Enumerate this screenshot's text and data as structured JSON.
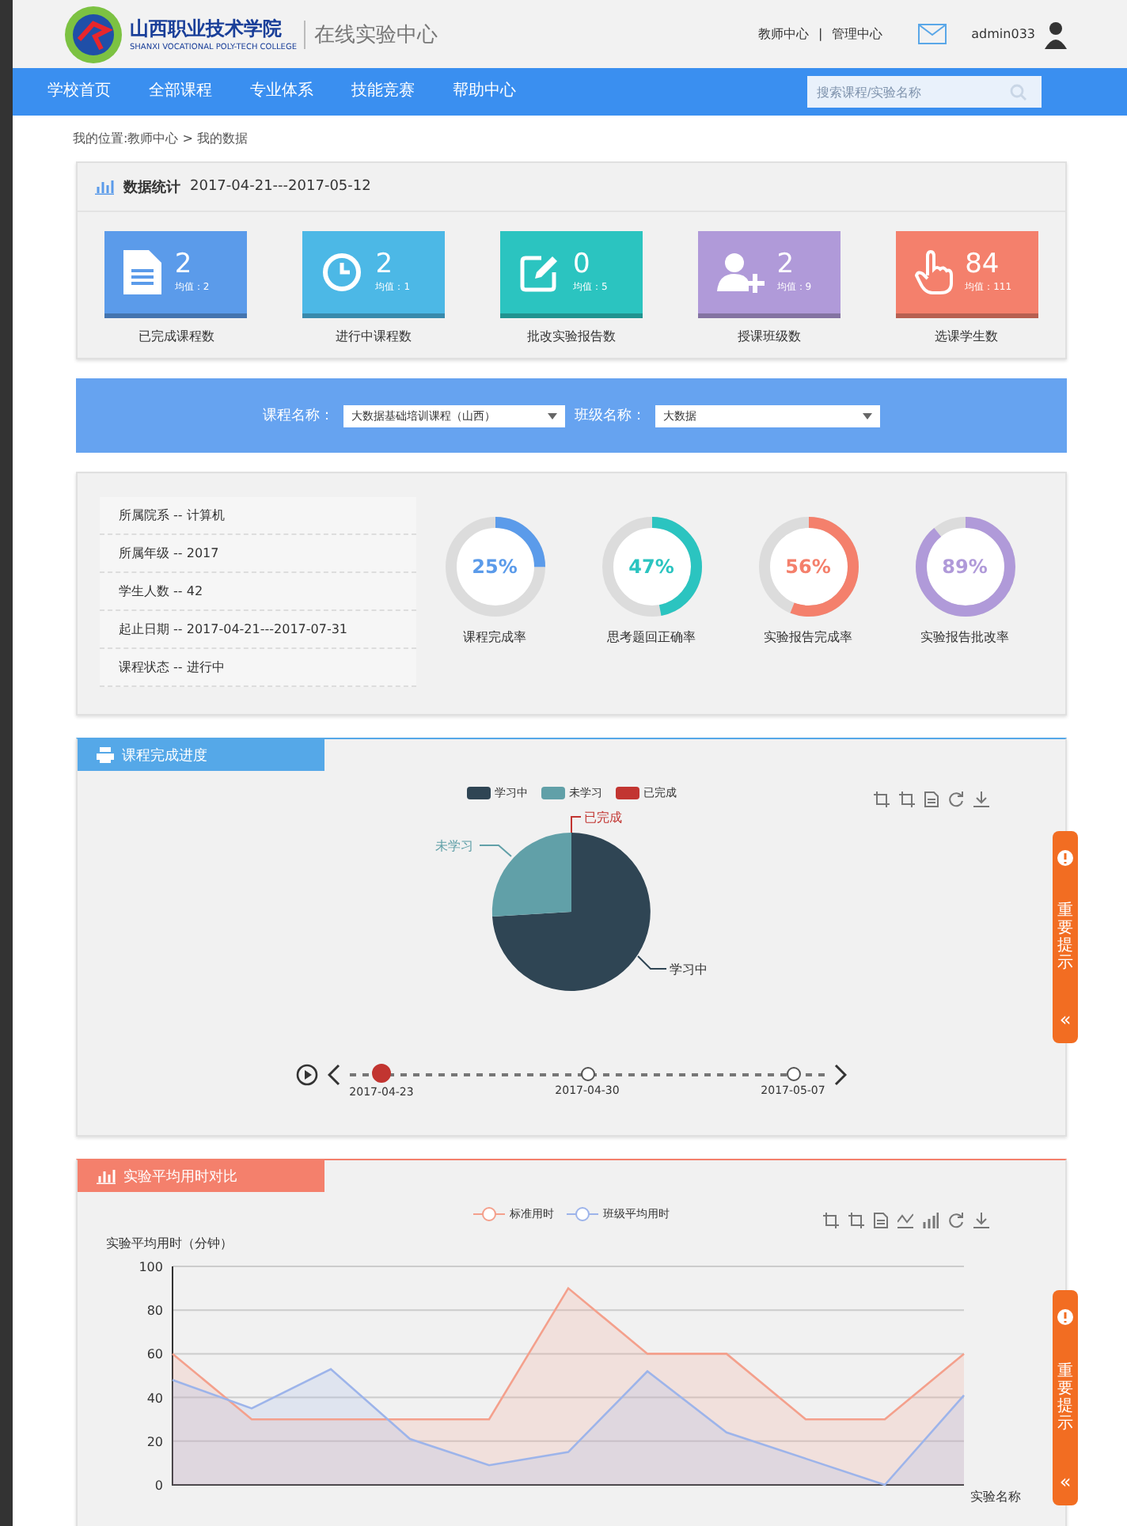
{
  "header": {
    "school_name": "山西职业技术学院",
    "school_name_en": "SHANXI VOCATIONAL POLY-TECH COLLEGE",
    "site_title": "在线实验中心",
    "links": [
      "教师中心",
      "管理中心"
    ],
    "separator": "|",
    "username": "admin033"
  },
  "nav": {
    "items": [
      {
        "label": "学校首页",
        "selected": false
      },
      {
        "label": "全部课程",
        "selected": false
      },
      {
        "label": "专业体系",
        "selected": false
      },
      {
        "label": "技能竞赛",
        "selected": false
      },
      {
        "label": "帮助中心",
        "selected": false
      }
    ],
    "search": {
      "placeholder": "搜索课程/实验名称"
    }
  },
  "breadcrumb": "我的位置:教师中心 > 我的数据",
  "stats": {
    "title": "数据统计",
    "range": "2017-04-21---2017-05-12",
    "cards": [
      {
        "kind": "document",
        "value": "2",
        "avg": "均值：2",
        "label": "已完成课程数",
        "color": "#5b9bea"
      },
      {
        "kind": "clock",
        "value": "2",
        "avg": "均值：1",
        "label": "进行中课程数",
        "color": "#4cb8e6"
      },
      {
        "kind": "edit",
        "value": "0",
        "avg": "均值：5",
        "label": "批改实验报告数",
        "color": "#2bc4c0"
      },
      {
        "kind": "add-user",
        "value": "2",
        "avg": "均值：9",
        "label": "授课班级数",
        "color": "#b09ad9"
      },
      {
        "kind": "hand",
        "value": "84",
        "avg": "均值：111",
        "label": "选课学生数",
        "color": "#f4806c"
      }
    ]
  },
  "filter": {
    "course_label": "课程名称：",
    "course_value": "大数据基础培训课程（山西）",
    "class_label": "班级名称：",
    "class_value": "大数据"
  },
  "course_info": {
    "rows": [
      "所属院系 -- 计算机",
      "所属年级 -- 2017",
      "学生人数 -- 42",
      "起止日期 -- 2017-04-21---2017-07-31",
      "课程状态 -- 进行中"
    ],
    "gauges": [
      {
        "reading": "25%",
        "level": 0.25,
        "label": "课程完成率",
        "color": "#5b9bea"
      },
      {
        "reading": "47%",
        "level": 0.47,
        "label": "思考题回正确率",
        "color": "#2bc4c0"
      },
      {
        "reading": "56%",
        "level": 0.56,
        "label": "实验报告完成率",
        "color": "#f4806c"
      },
      {
        "reading": "89%",
        "level": 0.89,
        "label": "实验报告批改率",
        "color": "#b09ad9"
      }
    ]
  },
  "progress_panel": {
    "title": "课程完成进度",
    "legend": [
      {
        "label": "学习中",
        "color": "#2f4554"
      },
      {
        "label": "未学习",
        "color": "#61a0a8"
      },
      {
        "label": "已完成",
        "color": "#c23531"
      }
    ],
    "slice_labels": [
      "已完成",
      "未学习",
      "学习中"
    ],
    "timeline": [
      {
        "date": "2017-04-23",
        "selected": true
      },
      {
        "date": "2017-04-30",
        "selected": false
      },
      {
        "date": "2017-05-07",
        "selected": false
      }
    ],
    "side_tab": "重要提示",
    "side_tab_arrow": "«"
  },
  "time_panel": {
    "title": "实验平均用时对比",
    "side_tab": "重要提示",
    "side_tab_arrow": "«",
    "chart_data": {
      "type": "area",
      "grid": true,
      "ylabel": "实验平均用时（分钟）",
      "xlabel": "实验名称",
      "ylim": [
        0,
        100
      ],
      "yticks": [
        0,
        20,
        40,
        60,
        80,
        100
      ],
      "series": [
        {
          "name": "标准用时",
          "color": "#f4a08c",
          "values": [
            60,
            30,
            30,
            30,
            30,
            90,
            60,
            60,
            30,
            30,
            60
          ]
        },
        {
          "name": "班级平均用时",
          "color": "#9db4ea",
          "values": [
            48,
            35,
            53,
            21,
            9,
            15,
            52,
            24,
            12,
            0,
            41
          ]
        }
      ]
    }
  }
}
